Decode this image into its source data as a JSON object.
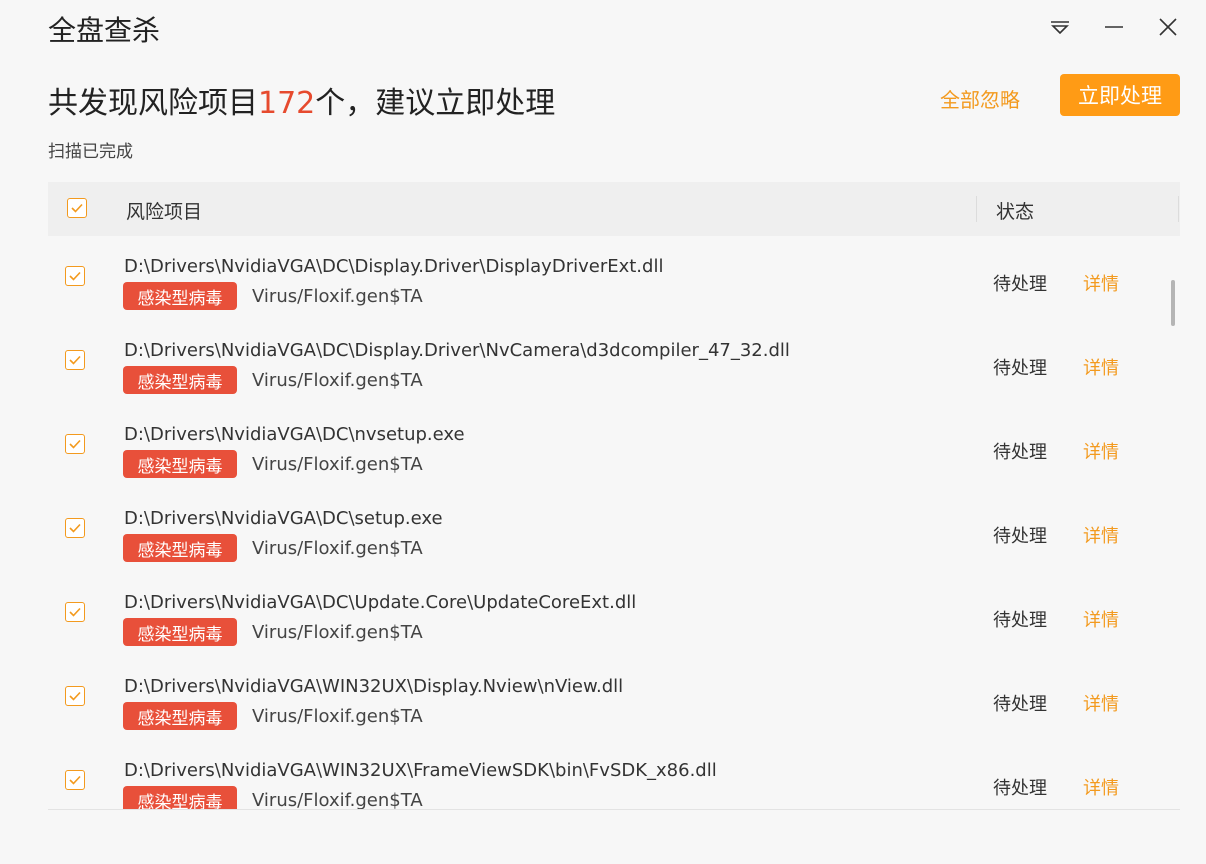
{
  "window": {
    "title": "全盘查杀",
    "controls": [
      "menu-icon",
      "minimize-icon",
      "close-icon"
    ]
  },
  "summary": {
    "prefix": "共发现风险项目",
    "count": "172",
    "suffix": "个，建议立即处理",
    "scan_status": "扫描已完成"
  },
  "actions": {
    "ignore_all": "全部忽略",
    "fix_now": "立即处理"
  },
  "table": {
    "header_item": "风险项目",
    "header_status": "状态",
    "rows": [
      {
        "path": "D:\\Drivers\\NvidiaVGA\\DC\\Display.Driver\\DisplayDriverExt.dll",
        "badge": "感染型病毒",
        "virus": "Virus/Floxif.gen$TA",
        "status": "待处理",
        "detail": "详情"
      },
      {
        "path": "D:\\Drivers\\NvidiaVGA\\DC\\Display.Driver\\NvCamera\\d3dcompiler_47_32.dll",
        "badge": "感染型病毒",
        "virus": "Virus/Floxif.gen$TA",
        "status": "待处理",
        "detail": "详情"
      },
      {
        "path": "D:\\Drivers\\NvidiaVGA\\DC\\nvsetup.exe",
        "badge": "感染型病毒",
        "virus": "Virus/Floxif.gen$TA",
        "status": "待处理",
        "detail": "详情"
      },
      {
        "path": "D:\\Drivers\\NvidiaVGA\\DC\\setup.exe",
        "badge": "感染型病毒",
        "virus": "Virus/Floxif.gen$TA",
        "status": "待处理",
        "detail": "详情"
      },
      {
        "path": "D:\\Drivers\\NvidiaVGA\\DC\\Update.Core\\UpdateCoreExt.dll",
        "badge": "感染型病毒",
        "virus": "Virus/Floxif.gen$TA",
        "status": "待处理",
        "detail": "详情"
      },
      {
        "path": "D:\\Drivers\\NvidiaVGA\\WIN32UX\\Display.Nview\\nView.dll",
        "badge": "感染型病毒",
        "virus": "Virus/Floxif.gen$TA",
        "status": "待处理",
        "detail": "详情"
      },
      {
        "path": "D:\\Drivers\\NvidiaVGA\\WIN32UX\\FrameViewSDK\\bin\\FvSDK_x86.dll",
        "badge": "感染型病毒",
        "virus": "Virus/Floxif.gen$TA",
        "status": "待处理",
        "detail": "详情"
      }
    ]
  },
  "colors": {
    "accent": "#ff9b15",
    "danger": "#e8503a",
    "count": "#e64a2e"
  }
}
